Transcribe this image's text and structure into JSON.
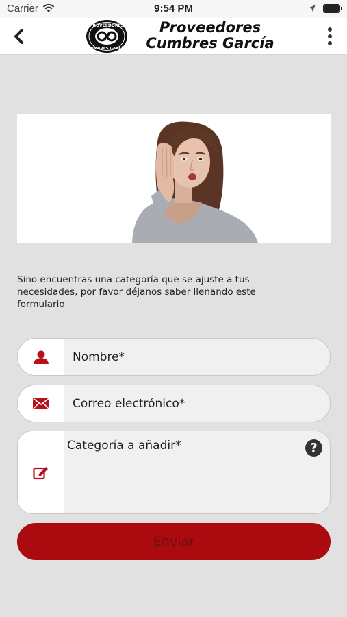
{
  "status_bar": {
    "carrier": "Carrier",
    "time": "9:54 PM"
  },
  "header": {
    "logo_line1": "Proveedores",
    "logo_line2": "Cumbres García",
    "seal_text_top": "PROVEEDORES",
    "seal_text_bottom": "CUMBRES GARCÍA"
  },
  "intro_text": "Sino encuentras una categoría que se ajuste a tus necesidades, por favor déjanos saber llenando este formulario",
  "form": {
    "name_placeholder": "Nombre*",
    "email_placeholder": "Correo electrónico*",
    "category_placeholder": "Categoría a añadir*",
    "help_glyph": "?",
    "submit_label": "Enviar"
  },
  "colors": {
    "accent": "#ab0a0e",
    "background": "#e1e1e1",
    "icon_red": "#b5121b"
  }
}
